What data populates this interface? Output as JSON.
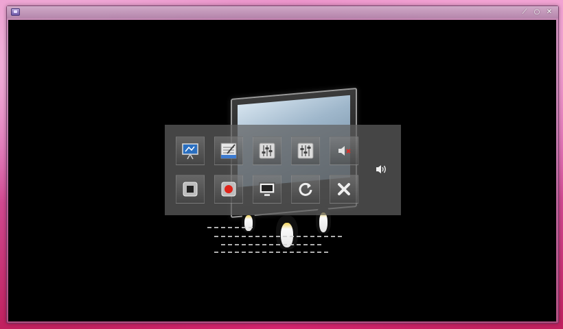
{
  "window": {
    "icon": "app-monitor-icon",
    "controls": [
      {
        "name": "minimize-button",
        "glyph": "⟋",
        "icon": "minimize-icon"
      },
      {
        "name": "maximize-button",
        "glyph": "○",
        "icon": "maximize-icon"
      },
      {
        "name": "close-button",
        "glyph": "✕",
        "icon": "close-icon"
      }
    ]
  },
  "osd": {
    "row1": [
      {
        "name": "presentation-button",
        "icon": "presentation-icon"
      },
      {
        "name": "playlist-button",
        "icon": "playlist-icon"
      },
      {
        "name": "video-equalizer-button",
        "icon": "equalizer-icon"
      },
      {
        "name": "audio-equalizer-button",
        "icon": "equalizer-icon"
      },
      {
        "name": "mute-button",
        "icon": "speaker-mute-icon"
      }
    ],
    "row2": [
      {
        "name": "stop-button",
        "icon": "stop-icon"
      },
      {
        "name": "record-button",
        "icon": "record-icon"
      },
      {
        "name": "screen-button",
        "icon": "screen-icon"
      },
      {
        "name": "refresh-button",
        "icon": "refresh-icon"
      },
      {
        "name": "close-osd-button",
        "icon": "close-x-icon"
      }
    ],
    "volume_icon": "speaker-volume-icon"
  },
  "colors": {
    "record": "#e0241a",
    "mute_x": "#d8302a",
    "panel": "#5f5f5f"
  }
}
